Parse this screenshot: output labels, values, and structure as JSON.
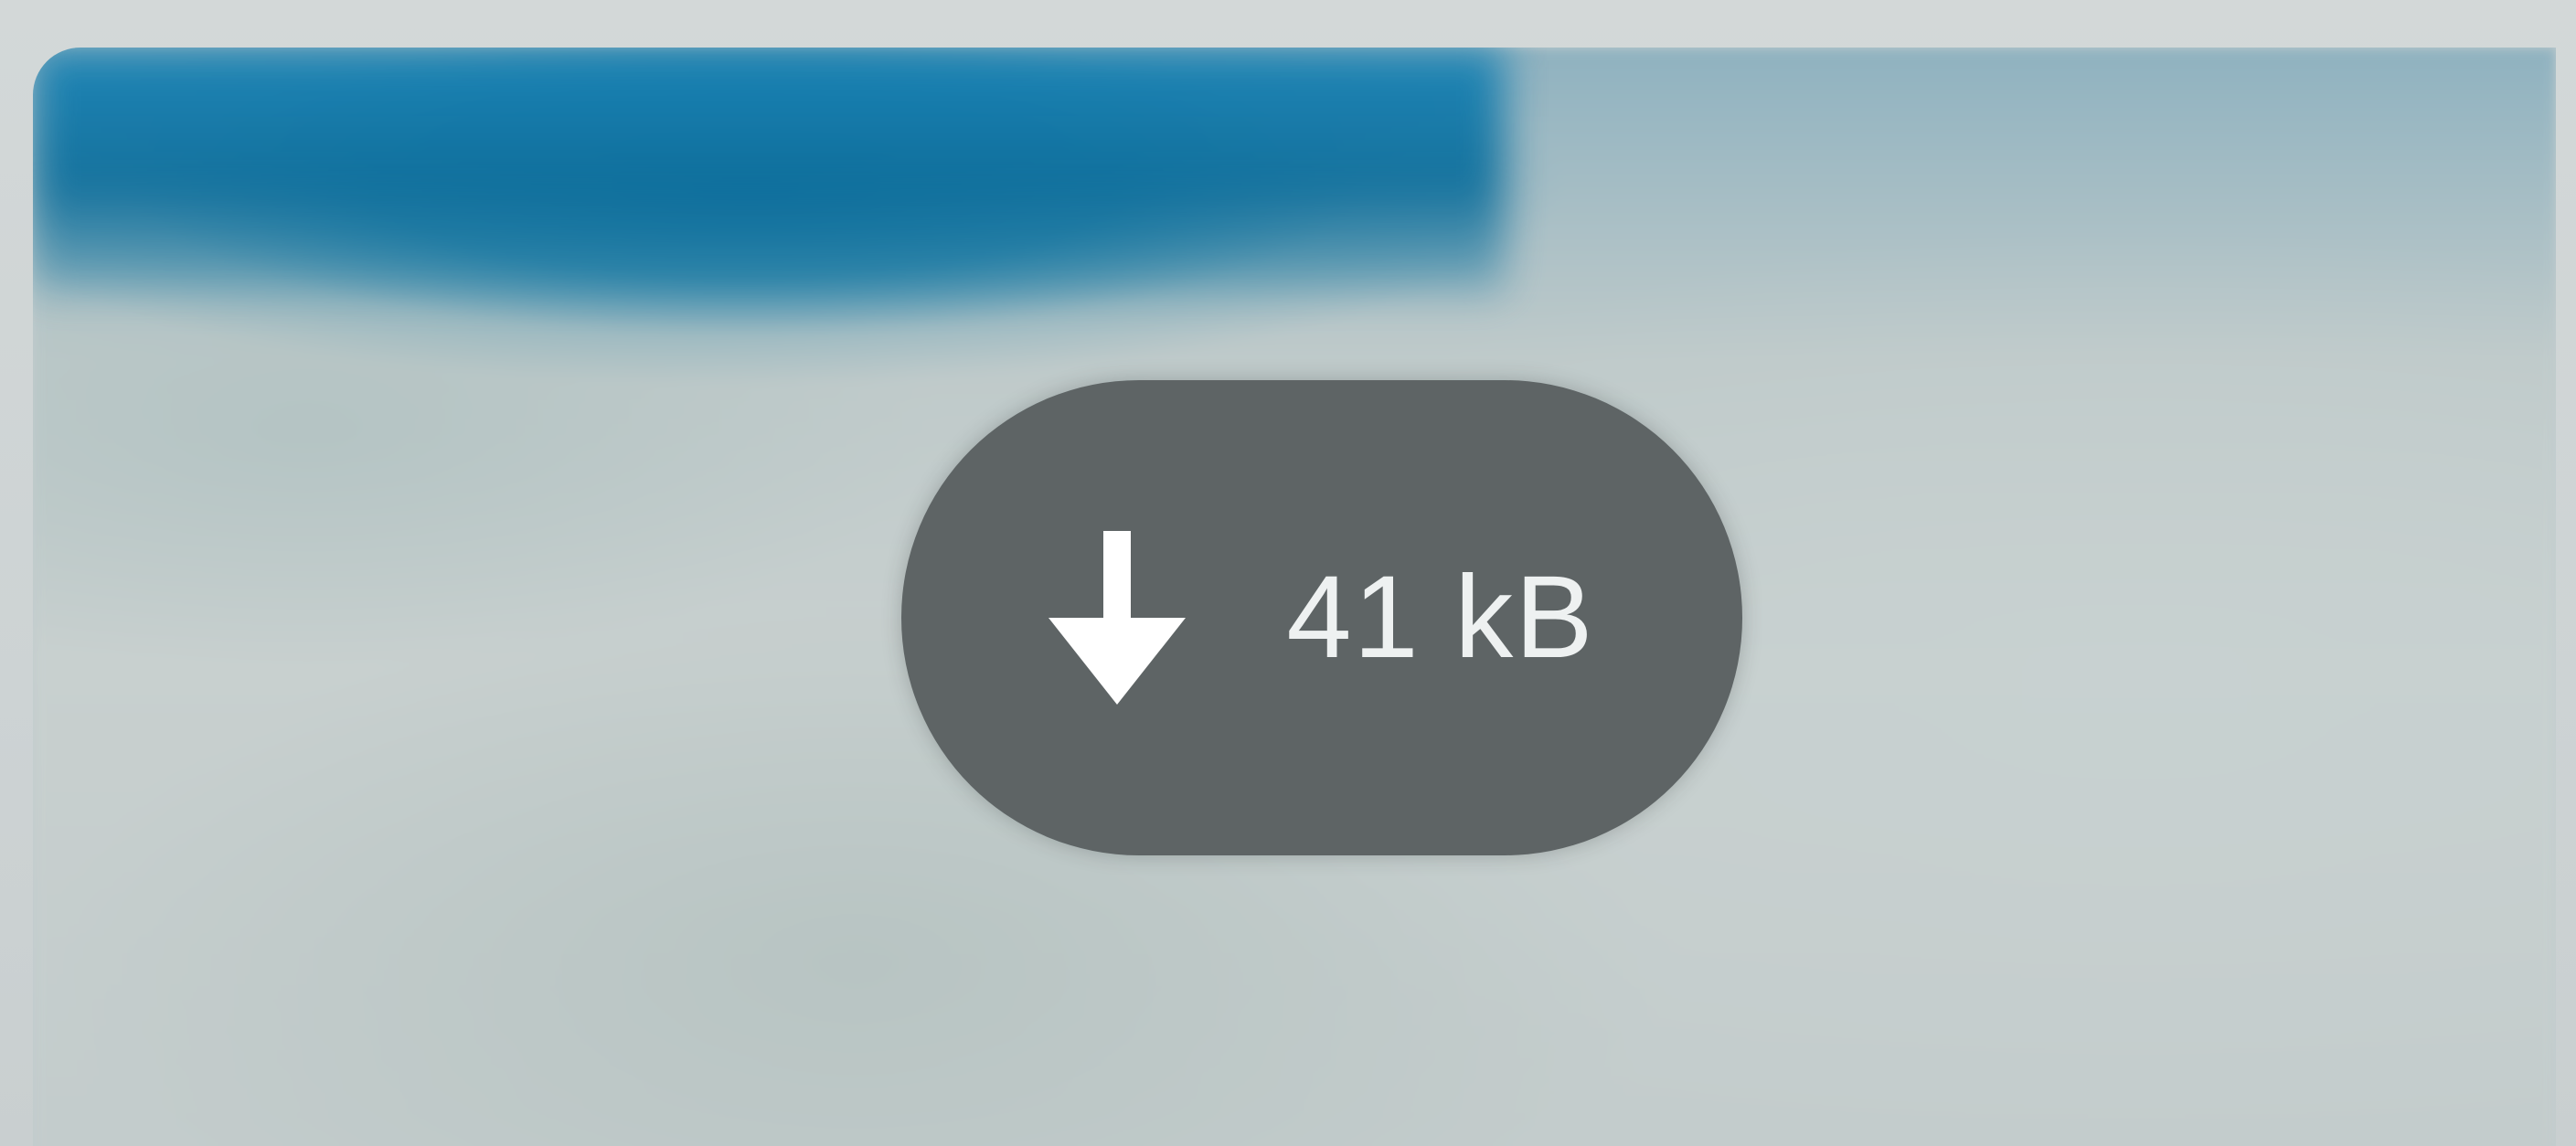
{
  "media_preview": {
    "download_button": {
      "icon": "arrow-down-icon",
      "size_label": "41 kB"
    }
  },
  "colors": {
    "pill_background": "#5e6465",
    "pill_text": "#eef1f1",
    "thumbnail_blue": "#1a84b6"
  }
}
